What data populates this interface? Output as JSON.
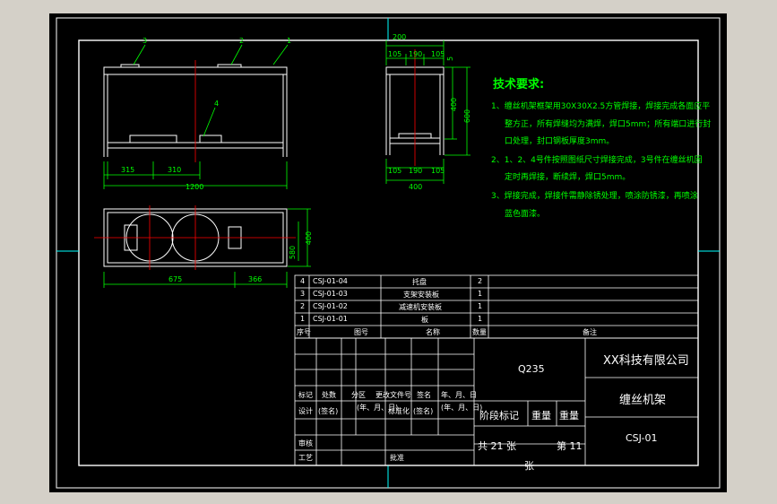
{
  "tech_requirements": {
    "title": "技术要求:",
    "items": [
      "1、缠丝机架框架用30X30X2.5方管焊接，焊接完成各面应平",
      "整方正，所有焊缝均为满焊，焊口5mm；所有端口进行封",
      "口处理，封口钢板厚度3mm。",
      "2、1、2、4号件按照图纸尺寸焊接完成，3号件在缠丝机固",
      "定时再焊接，断续焊，焊口5mm。",
      "3、焊接完成，焊接件需静除锈处理，喷涂防锈漆，再喷涂",
      "蓝色面漆。"
    ]
  },
  "dimensions": {
    "front_315": "315",
    "front_310": "310",
    "front_1200": "1200",
    "side_200": "200",
    "side_105a": "105",
    "side_190a": "190",
    "side_105b": "105",
    "side_105c": "105",
    "side_190b": "190",
    "side_105d": "105",
    "side_400": "400",
    "side_h1": "400",
    "side_h2": "600",
    "side_top": "5",
    "top_400": "400",
    "top_580": "580",
    "top_675": "675",
    "top_366": "366"
  },
  "balloons": [
    "3",
    "2",
    "1",
    "4"
  ],
  "bom": {
    "rows": [
      {
        "no": "4",
        "code": "CSJ-01-04",
        "name": "托盘",
        "qty": "2"
      },
      {
        "no": "3",
        "code": "CSJ-01-03",
        "name": "支架安装板",
        "qty": "1"
      },
      {
        "no": "2",
        "code": "CSJ-01-02",
        "name": "减速机安装板",
        "qty": "1"
      },
      {
        "no": "1",
        "code": "CSJ-01-01",
        "name": "板",
        "qty": "1"
      }
    ],
    "header": {
      "no": "序号",
      "code": "图号",
      "name": "名称",
      "qty": "数量",
      "note": "备注"
    }
  },
  "title_block": {
    "material": "Q235",
    "company": "XX科技有限公司",
    "drawing_name": "缠丝机架",
    "drawing_no": "CSJ-01",
    "stage_label": "阶段标记",
    "weight_label": "重量",
    "scale_label": "重量",
    "sheets_total": "共 21 张",
    "sheet_no": "第 11",
    "sheet_unit": "张",
    "labels": {
      "mark": "标记",
      "count": "处数",
      "zone": "分区",
      "change_doc": "更改文件号",
      "sign": "签名",
      "date": "年、月、日",
      "design": "设计",
      "design_sign": "(签名)",
      "date2": "(年、月、日)",
      "standard": "标准化",
      "standard_sign": "(签名)",
      "date3": "(年、月、日)",
      "review": "审核",
      "process": "工艺",
      "approve": "批准"
    }
  },
  "colors": {
    "geometry": "#ffffff",
    "dimension": "#00ff00",
    "centerline": "#ff0000",
    "frame": "#ffffff",
    "axis": "#00ffff",
    "background": "#000000"
  }
}
